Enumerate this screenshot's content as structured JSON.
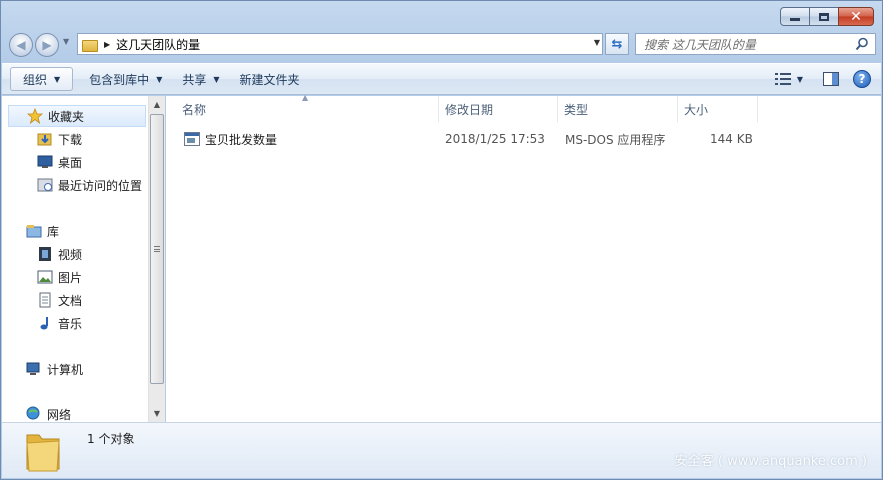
{
  "window": {
    "caption": {
      "minimize": "—",
      "maximize": "□",
      "close": "✕"
    }
  },
  "address": {
    "path": "这几天团队的量",
    "search_placeholder": "搜索 这几天团队的量"
  },
  "toolbar": {
    "organize": "组织",
    "include_in_library": "包含到库中",
    "share": "共享",
    "new_folder": "新建文件夹",
    "help": "?"
  },
  "nav_pane": {
    "favorites": "收藏夹",
    "downloads": "下载",
    "desktop": "桌面",
    "recent": "最近访问的位置",
    "libraries": "库",
    "videos": "视频",
    "pictures": "图片",
    "documents": "文档",
    "music": "音乐",
    "computer": "计算机",
    "network": "网络"
  },
  "columns": {
    "name": "名称",
    "date": "修改日期",
    "type": "类型",
    "size": "大小"
  },
  "files": [
    {
      "name": "宝贝批发数量",
      "date": "2018/1/25 17:53",
      "type": "MS-DOS 应用程序",
      "size": "144 KB"
    }
  ],
  "status": {
    "count": "1 个对象"
  },
  "watermark": "安全客 ( www.anquanke.com )"
}
